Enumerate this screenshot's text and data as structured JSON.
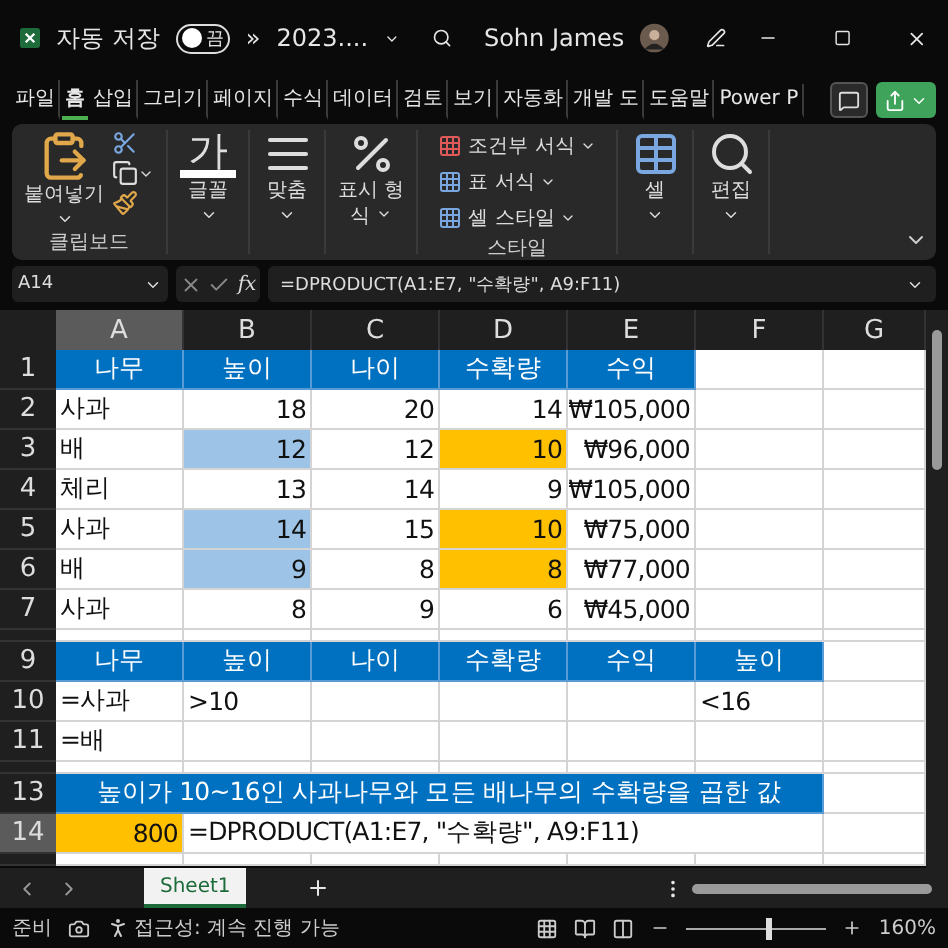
{
  "title_bar": {
    "autosave_label": "자동 저장",
    "autosave": {
      "on": false,
      "label": "끔"
    },
    "overflow": "»",
    "file_name": "2023....",
    "user_name": "Sohn James"
  },
  "ribbon_tabs": [
    {
      "label": "파일",
      "selected": false
    },
    {
      "label": "홈",
      "selected": true
    },
    {
      "label": "삽입",
      "selected": false
    },
    {
      "label": "그리기",
      "selected": false
    },
    {
      "label": "페이지",
      "selected": false
    },
    {
      "label": "수식",
      "selected": false
    },
    {
      "label": "데이터",
      "selected": false
    },
    {
      "label": "검토",
      "selected": false
    },
    {
      "label": "보기",
      "selected": false
    },
    {
      "label": "자동화",
      "selected": false
    },
    {
      "label": "개발 도",
      "selected": false
    },
    {
      "label": "도움말",
      "selected": false
    },
    {
      "label": "Power P",
      "selected": false
    }
  ],
  "ribbon": {
    "groups": [
      {
        "kind": "clipboard",
        "button": "붙여넣기",
        "label": "클립보드"
      },
      {
        "kind": "font",
        "glyph": "가",
        "button": "글꼴"
      },
      {
        "kind": "alignment",
        "button": "맞춤"
      },
      {
        "kind": "number",
        "button": "표시 형",
        "button_2": "식"
      },
      {
        "kind": "styles",
        "items": [
          "조건부 서식",
          "표 서식",
          "셀 스타일"
        ],
        "label": "스타일"
      },
      {
        "kind": "cells",
        "button": "셀"
      },
      {
        "kind": "editing",
        "button": "편집"
      }
    ]
  },
  "formula_bar": {
    "name_box": "A14",
    "function_label": "fx",
    "formula": "=DPRODUCT(A1:E7, \"수확량\", A9:F11)"
  },
  "sheet": {
    "columns": [
      {
        "label": "A",
        "selected": true
      },
      {
        "label": "B",
        "selected": false
      },
      {
        "label": "C",
        "selected": false
      },
      {
        "label": "D",
        "selected": false
      },
      {
        "label": "E",
        "selected": false
      },
      {
        "label": "F",
        "selected": false
      },
      {
        "label": "G",
        "selected": false
      }
    ],
    "rows": [
      {
        "kind": "row",
        "number": "1",
        "selected": false,
        "cells": [
          {
            "kind": "header",
            "text": "나무"
          },
          {
            "kind": "header",
            "text": "높이"
          },
          {
            "kind": "header",
            "text": "나이"
          },
          {
            "kind": "header",
            "text": "수확량"
          },
          {
            "kind": "header",
            "text": "수익"
          }
        ]
      },
      {
        "kind": "row",
        "number": "2",
        "selected": false,
        "cells": [
          {
            "kind": "text",
            "text": "사과"
          },
          {
            "kind": "number",
            "text": "18"
          },
          {
            "kind": "number",
            "text": "20"
          },
          {
            "kind": "number",
            "text": "14"
          },
          {
            "kind": "number",
            "text": "₩105,000"
          }
        ]
      },
      {
        "kind": "row",
        "number": "3",
        "selected": false,
        "cells": [
          {
            "kind": "text",
            "text": "배"
          },
          {
            "kind": "number",
            "text": "12",
            "color": "#9dc3e6"
          },
          {
            "kind": "number",
            "text": "12"
          },
          {
            "kind": "number",
            "text": "10",
            "color": "#ffc000"
          },
          {
            "kind": "number",
            "text": "₩96,000"
          }
        ]
      },
      {
        "kind": "row",
        "number": "4",
        "selected": false,
        "cells": [
          {
            "kind": "text",
            "text": "체리"
          },
          {
            "kind": "number",
            "text": "13"
          },
          {
            "kind": "number",
            "text": "14"
          },
          {
            "kind": "number",
            "text": "9"
          },
          {
            "kind": "number",
            "text": "₩105,000"
          }
        ]
      },
      {
        "kind": "row",
        "number": "5",
        "selected": false,
        "cells": [
          {
            "kind": "text",
            "text": "사과"
          },
          {
            "kind": "number",
            "text": "14",
            "color": "#9dc3e6"
          },
          {
            "kind": "number",
            "text": "15"
          },
          {
            "kind": "number",
            "text": "10",
            "color": "#ffc000"
          },
          {
            "kind": "number",
            "text": "₩75,000"
          }
        ]
      },
      {
        "kind": "row",
        "number": "6",
        "selected": false,
        "cells": [
          {
            "kind": "text",
            "text": "배"
          },
          {
            "kind": "number",
            "text": "9",
            "color": "#9dc3e6"
          },
          {
            "kind": "number",
            "text": "8"
          },
          {
            "kind": "number",
            "text": "8",
            "color": "#ffc000"
          },
          {
            "kind": "number",
            "text": "₩77,000"
          }
        ]
      },
      {
        "kind": "row",
        "number": "7",
        "selected": false,
        "cells": [
          {
            "kind": "text",
            "text": "사과"
          },
          {
            "kind": "number",
            "text": "8"
          },
          {
            "kind": "number",
            "text": "9"
          },
          {
            "kind": "number",
            "text": "6"
          },
          {
            "kind": "number",
            "text": "₩45,000"
          }
        ]
      },
      {
        "kind": "sliver"
      },
      {
        "kind": "row",
        "number": "9",
        "selected": false,
        "cells": [
          {
            "kind": "header",
            "text": "나무"
          },
          {
            "kind": "header",
            "text": "높이"
          },
          {
            "kind": "header",
            "text": "나이"
          },
          {
            "kind": "header",
            "text": "수확량"
          },
          {
            "kind": "header",
            "text": "수익"
          },
          {
            "kind": "header",
            "text": "높이"
          }
        ]
      },
      {
        "kind": "row",
        "number": "10",
        "selected": false,
        "cells": [
          {
            "kind": "text",
            "text": "=사과"
          },
          {
            "kind": "text",
            "text": ">10"
          },
          {
            "kind": "empty"
          },
          {
            "kind": "empty"
          },
          {
            "kind": "empty"
          },
          {
            "kind": "text",
            "text": "<16"
          }
        ]
      },
      {
        "kind": "row",
        "number": "11",
        "selected": false,
        "cells": [
          {
            "kind": "text",
            "text": "=배"
          }
        ]
      },
      {
        "kind": "sliver"
      },
      {
        "kind": "row",
        "number": "13",
        "selected": false,
        "cells": [
          {
            "kind": "banner",
            "text": "높이가 10~16인 사과나무와 모든 배나무의 수확량을 곱한 값"
          }
        ]
      },
      {
        "kind": "row",
        "number": "14",
        "selected": true,
        "cells": [
          {
            "kind": "number",
            "text": "800",
            "color": "#ffc000"
          },
          {
            "kind": "formula",
            "text": "=DPRODUCT(A1:E7, \"수확량\", A9:F11)"
          }
        ]
      },
      {
        "kind": "sliver"
      }
    ]
  },
  "sheet_tabs": [
    {
      "label": "Sheet1",
      "selected": true
    }
  ],
  "status_bar": {
    "ready": "준비",
    "accessibility": "접근성: 계속 진행 가능",
    "zoom": "160%",
    "zoom_slider": {
      "level": 0.6
    }
  }
}
